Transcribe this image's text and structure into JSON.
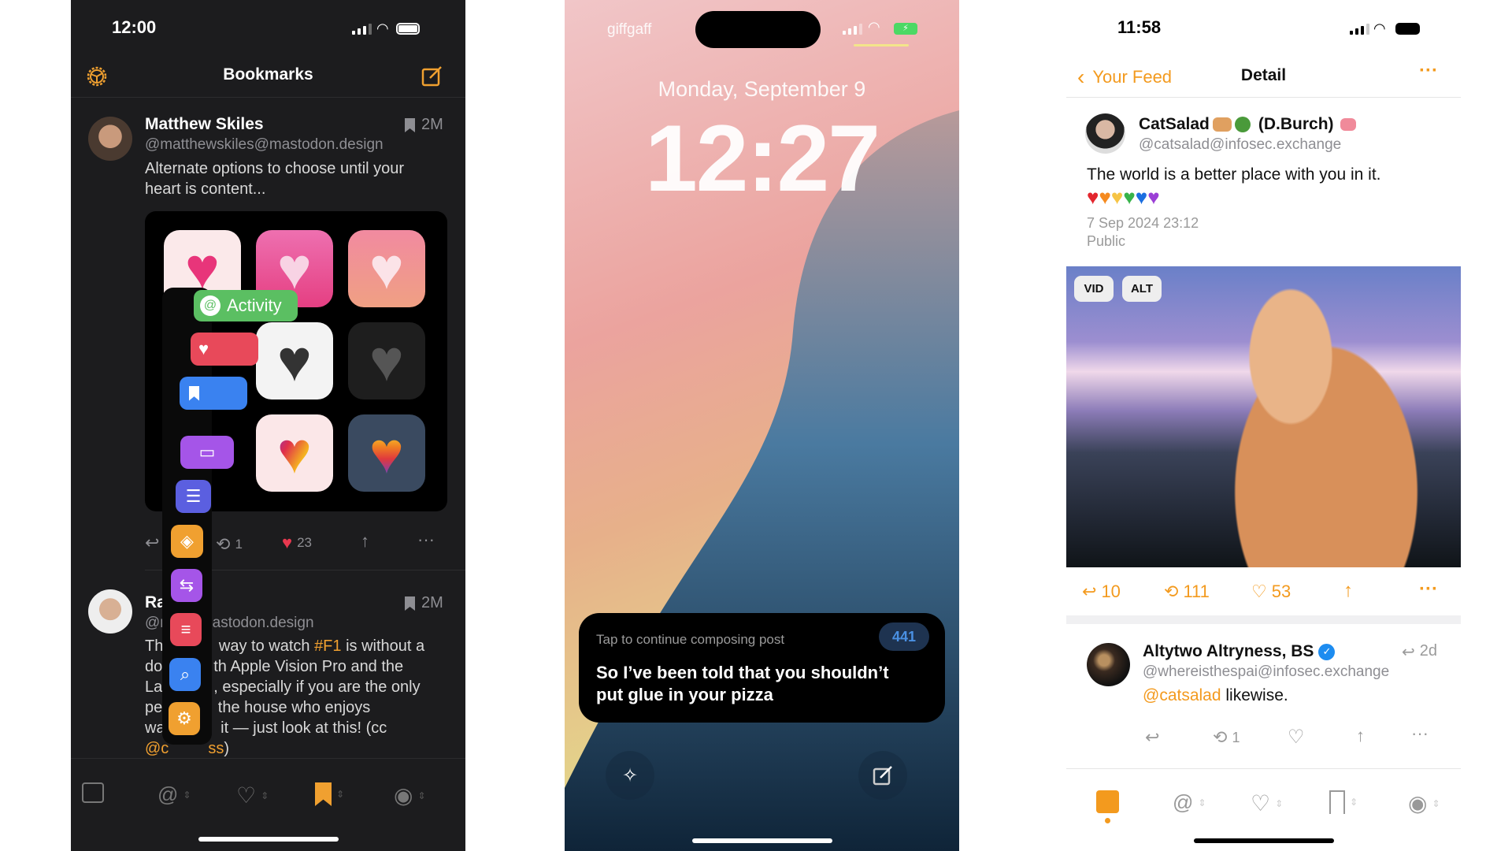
{
  "phone_bookmarks": {
    "status_time": "12:00",
    "nav": {
      "title": "Bookmarks",
      "settings_icon": "gear-icon",
      "compose_icon": "compose-icon"
    },
    "accent": "#f0a030",
    "posts": [
      {
        "name": "Matthew Skiles",
        "handle": "@matthewskiles@mastodon.design",
        "age": "2M",
        "body": "Alternate options to choose until your heart is content...",
        "reposts": "1",
        "likes": "23"
      },
      {
        "name": "Ra",
        "handle_visible_start": "@r",
        "handle_visible_end": "astodon.design",
        "age": "2M",
        "body_lines": [
          {
            "pre": "Th",
            "post": " way to watch ",
            "tag": "#F1",
            "tail": " is without a"
          },
          {
            "pre": "do",
            "post": "th Apple Vision Pro and the"
          },
          {
            "pre": "La",
            "post": ", especially if you are the only"
          },
          {
            "pre": "pe",
            "post": " the house who enjoys"
          },
          {
            "pre": "wa",
            "post": " it — just look at this! (cc"
          }
        ],
        "mention_start": "@c",
        "mention_end": "ss",
        "close": ")"
      }
    ],
    "activity_label": "Activity",
    "tabs": [
      "feed",
      "mentions",
      "favourites",
      "bookmarks",
      "profile"
    ],
    "active_tab": "bookmarks"
  },
  "phone_lock": {
    "carrier": "giffgaff",
    "date": "Monday, September 9",
    "time": "12:27",
    "widget": {
      "hint": "Tap to continue composing post",
      "count": "441",
      "text": "So I’ve been told that you shouldn’t put glue in your pizza"
    },
    "count_color": "#4a90e2"
  },
  "phone_detail": {
    "status_time": "11:58",
    "nav": {
      "back_label": "Your Feed",
      "title": "Detail"
    },
    "post": {
      "name_a": "CatSalad",
      "name_b": "(D.Burch)",
      "handle": "@catsalad@infosec.exchange",
      "body": "The world is a better place with you in it.",
      "hearts": [
        "#e3262e",
        "#f58a1f",
        "#f6c445",
        "#37b34a",
        "#1c6fe0",
        "#9b3fd6"
      ],
      "date": "7 Sep 2024 23:12",
      "visibility": "Public",
      "media_badges": [
        "VID",
        "ALT"
      ],
      "replies": "10",
      "reposts": "111",
      "likes": "53"
    },
    "reply": {
      "name": "Altytwo Altryness, BS",
      "handle": "@whereisthespai@infosec.exchange",
      "age": "2d",
      "mention": "@catsalad",
      "body": " likewise.",
      "reposts": "1"
    },
    "tabs": [
      "feed",
      "mentions",
      "favourites",
      "bookmarks",
      "profile"
    ],
    "active_tab": "feed",
    "accent": "#f39a1e"
  }
}
